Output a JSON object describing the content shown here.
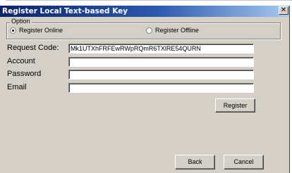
{
  "window": {
    "title": "Register Local Text-based Key",
    "close_glyph": "✕"
  },
  "option_group": {
    "legend": "Option",
    "register_online_label": "Register Online",
    "register_offline_label": "Register Offline",
    "selected": "Register Online"
  },
  "form": {
    "request_code_label": "Request Code:",
    "request_code_value": "Mk1UTXhFRFEwRWpRQmR6TXlRE54QURN",
    "account_label": "Account",
    "account_value": "",
    "password_label": "Password",
    "password_value": "",
    "email_label": "Email",
    "email_value": ""
  },
  "buttons": {
    "register_label": "Register",
    "back_label": "Back",
    "cancel_label": "Cancel"
  }
}
